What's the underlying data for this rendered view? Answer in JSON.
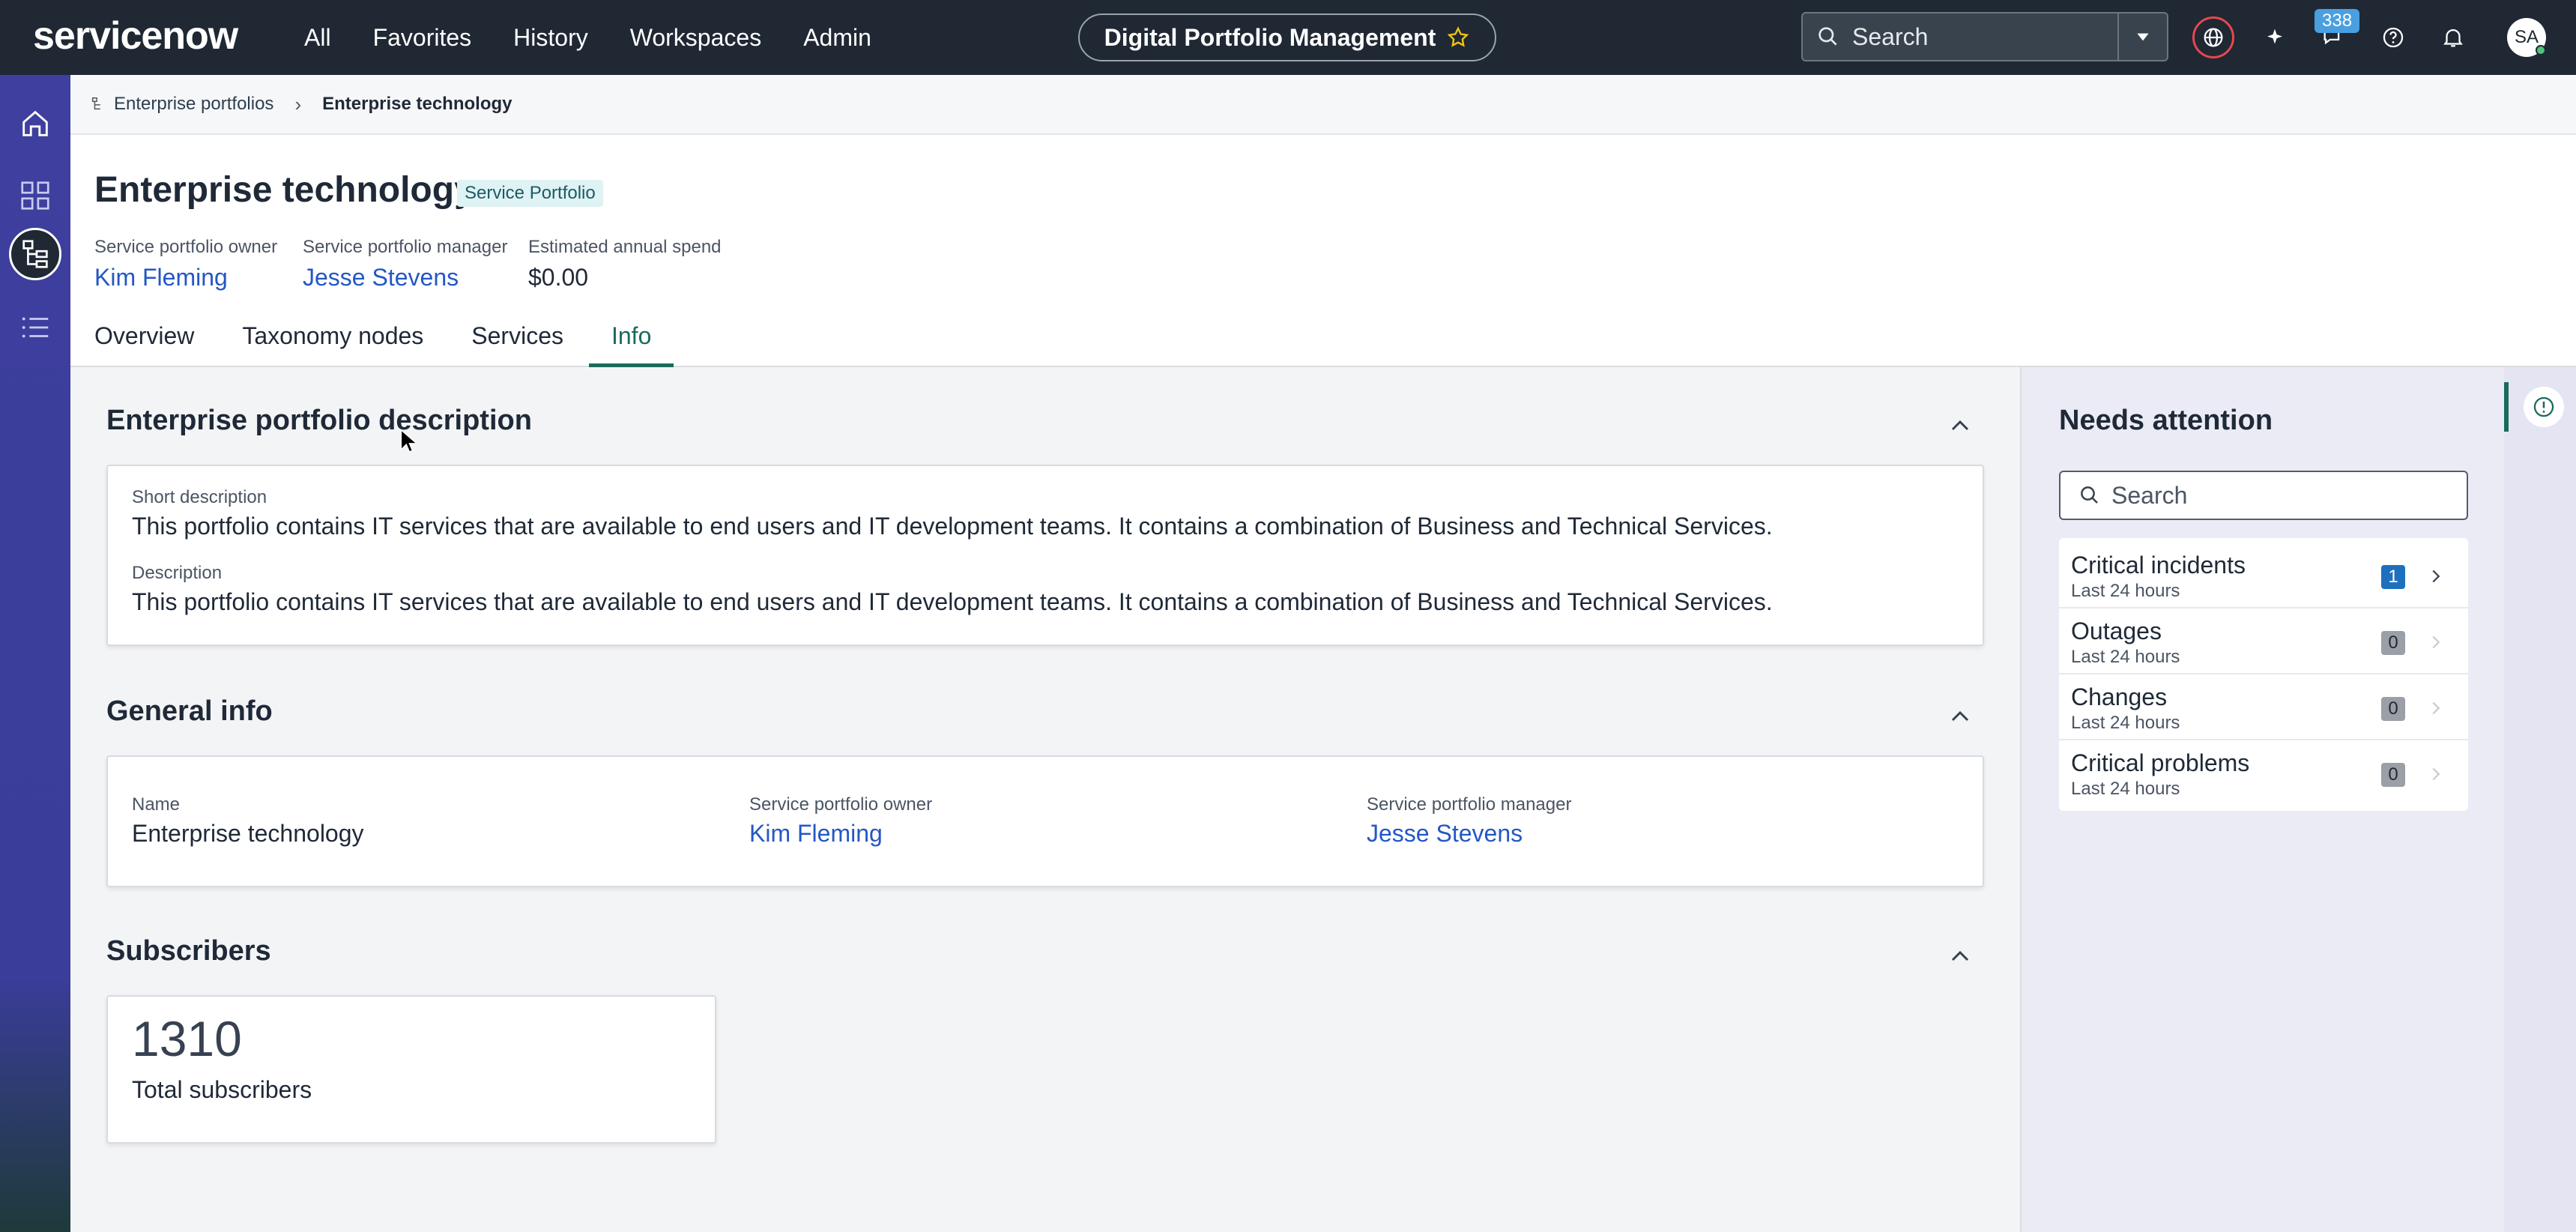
{
  "header": {
    "logo": "servicenow",
    "nav": [
      "All",
      "Favorites",
      "History",
      "Workspaces",
      "Admin"
    ],
    "workspace": "Digital Portfolio Management",
    "search_placeholder": "Search",
    "notification_count": "338",
    "avatar_initials": "SA",
    "accent": "#1f2833"
  },
  "breadcrumb": {
    "parent": "Enterprise portfolios",
    "current": "Enterprise technology"
  },
  "page": {
    "title": "Enterprise technology",
    "type_badge": "Service Portfolio",
    "meta": [
      {
        "label": "Service portfolio owner",
        "value": "Kim Fleming"
      },
      {
        "label": "Service portfolio manager",
        "value": "Jesse Stevens"
      },
      {
        "label": "Estimated annual spend",
        "value": "$0.00"
      }
    ],
    "tabs": [
      "Overview",
      "Taxonomy nodes",
      "Services",
      "Info"
    ],
    "active_tab": "Info"
  },
  "description_section": {
    "title": "Enterprise portfolio description",
    "short_label": "Short description",
    "short_value": "This portfolio contains IT services that are available to end users and IT development teams. It contains a combination of Business and Technical Services.",
    "desc_label": "Description",
    "desc_value": "This portfolio contains IT services that are available to end users and IT development teams. It contains a combination of Business and Technical Services."
  },
  "general_info": {
    "title": "General info",
    "fields": [
      {
        "label": "Name",
        "value": "Enterprise technology"
      },
      {
        "label": "Service portfolio owner",
        "value": "Kim Fleming"
      },
      {
        "label": "Service portfolio manager",
        "value": "Jesse Stevens"
      }
    ]
  },
  "subscribers": {
    "title": "Subscribers",
    "count": "1310",
    "label": "Total subscribers"
  },
  "needs_attention": {
    "title": "Needs attention",
    "search_placeholder": "Search",
    "items": [
      {
        "name": "Critical incidents",
        "sub": "Last 24 hours",
        "count": "1",
        "color": "#1f6fbf"
      },
      {
        "name": "Outages",
        "sub": "Last 24 hours",
        "count": "0",
        "color": "#8a9098"
      },
      {
        "name": "Changes",
        "sub": "Last 24 hours",
        "count": "0",
        "color": "#8a9098"
      },
      {
        "name": "Critical problems",
        "sub": "Last 24 hours",
        "count": "0",
        "color": "#8a9098"
      }
    ]
  }
}
